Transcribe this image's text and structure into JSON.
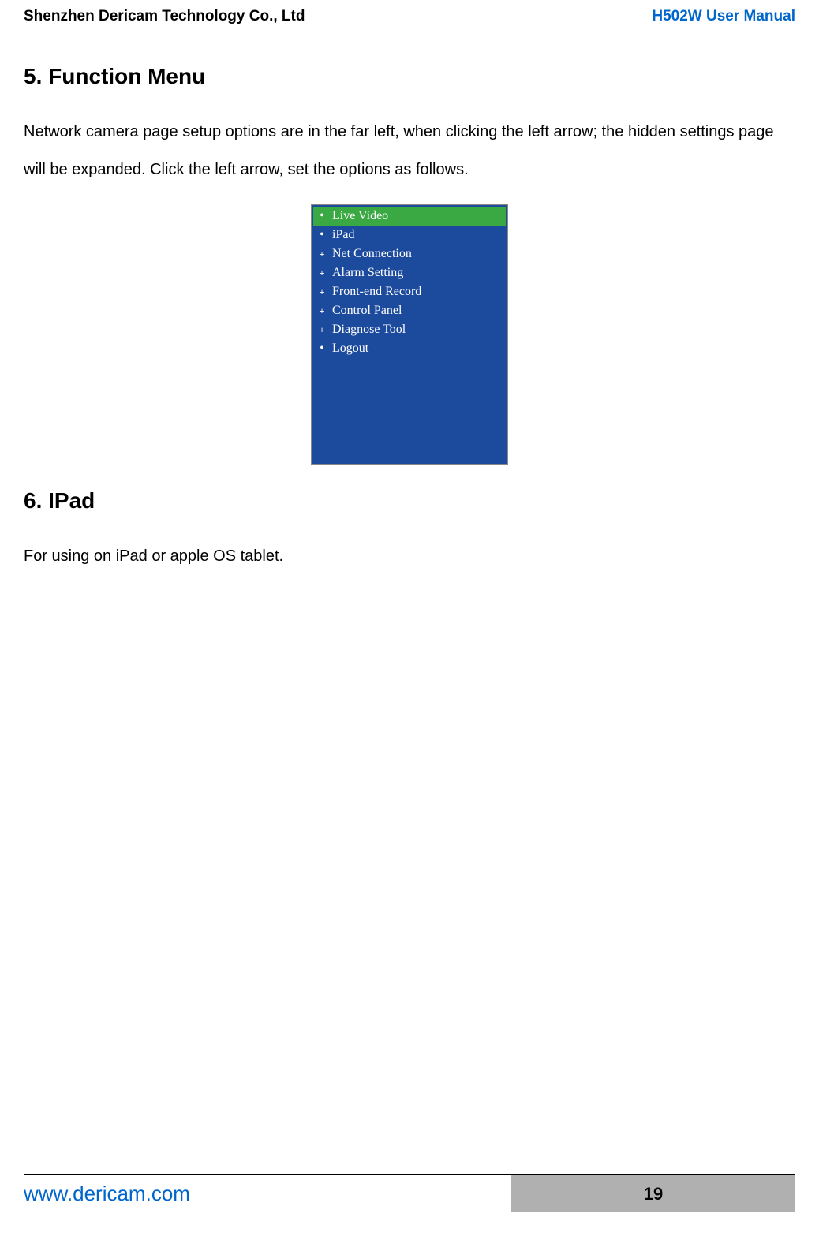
{
  "header": {
    "company": "Shenzhen Dericam Technology Co., Ltd",
    "manual": "H502W User Manual"
  },
  "section5": {
    "heading": "5. Function Menu",
    "paragraph": "Network camera page setup options are in the far left, when clicking the left arrow; the hidden settings page will be expanded. Click the left arrow, set the options as follows."
  },
  "menu": {
    "items": [
      {
        "label": "Live Video",
        "icon": "dot",
        "active": true
      },
      {
        "label": "iPad",
        "icon": "dot",
        "active": false
      },
      {
        "label": "Net Connection",
        "icon": "plus",
        "active": false
      },
      {
        "label": "Alarm Setting",
        "icon": "plus",
        "active": false
      },
      {
        "label": "Front-end Record",
        "icon": "plus",
        "active": false
      },
      {
        "label": "Control Panel",
        "icon": "plus",
        "active": false
      },
      {
        "label": "Diagnose Tool",
        "icon": "plus",
        "active": false
      },
      {
        "label": "Logout",
        "icon": "dot",
        "active": false
      }
    ]
  },
  "section6": {
    "heading": "6. IPad",
    "paragraph": "For using on iPad or apple OS tablet."
  },
  "footer": {
    "website": "www.dericam.com",
    "page": "19"
  }
}
